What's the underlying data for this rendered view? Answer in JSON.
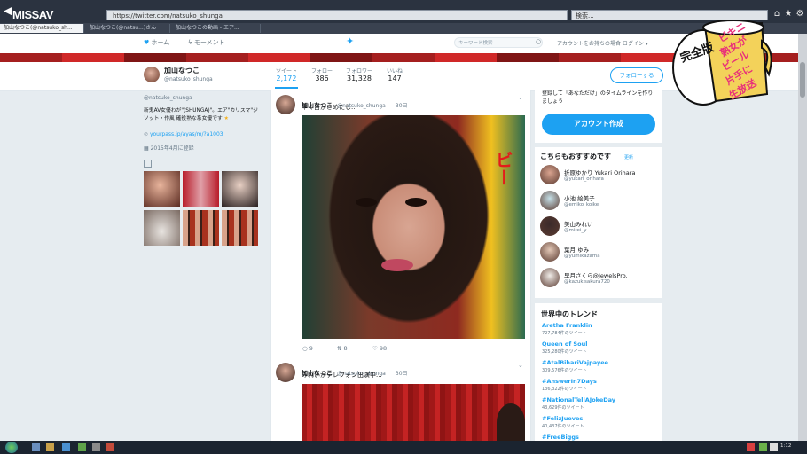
{
  "watermark": "MISSAV",
  "browser": {
    "url": "https://twitter.com/natsuko_shunga",
    "search_placeholder": "検索...",
    "tabs": [
      "加山なつこ(@natsuko_sh...",
      "加山なつこ(@natsu...)さん",
      "加山なつこの動画 - エア..."
    ]
  },
  "nav": {
    "home": "ホーム",
    "moments": "モーメント",
    "search_placeholder": "キーワード検索",
    "login_prompt": "アカウントをお持ちの場合 ログイン ▾"
  },
  "profile": {
    "name": "加山なつこ",
    "handle": "@natsuko_shunga",
    "bio": "新鬼AV女優わが\"(SHUNGA)\"。エア\"カリスマ\"ジ ソット・作風 確役熟な系女優です",
    "link": "yourpass.jp/ayas/m/?a1003",
    "joined": "2015年4月に登録",
    "follow_button": "フォローする"
  },
  "stats": [
    {
      "label": "ツイート",
      "value": "2,172"
    },
    {
      "label": "フォロー",
      "value": "386"
    },
    {
      "label": "フォロワー",
      "value": "31,328"
    },
    {
      "label": "いいね",
      "value": "147"
    }
  ],
  "tweets": [
    {
      "name": "加山なつこ",
      "handle": "@natsuko_shunga",
      "time": "30日",
      "text": "早く目がさめたし...",
      "image_sign": "ビー",
      "replies": "9",
      "retweets": "8",
      "likes": "98"
    },
    {
      "name": "加山なつこ",
      "handle": "@natsuko_shunga",
      "time": "30日",
      "text": "みれいがテレフォン出演中..."
    }
  ],
  "signup": {
    "text": "登録して「あなただけ」のタイムラインを作りましょう",
    "button": "アカウント作成"
  },
  "recommend": {
    "title": "こちらもおすすめです",
    "refresh": "更新",
    "users": [
      {
        "name": "折原ゆかり Yukari Orihara",
        "handle": "@yukari_orihara",
        "color": "#d9a38f"
      },
      {
        "name": "小池 絵美子",
        "handle": "@emiko_koike",
        "color": "#c5e0e8"
      },
      {
        "name": "美山みれい",
        "handle": "@mirei_y",
        "color": "#3b2a2a"
      },
      {
        "name": "葉月 ゆみ",
        "handle": "@yumikazama",
        "color": "#e2c7b6"
      },
      {
        "name": "早月さくら@JewelsPro.",
        "handle": "@kazukisakura720",
        "color": "#f0ece8"
      }
    ]
  },
  "trends": {
    "title": "世界中のトレンド",
    "items": [
      {
        "name": "Aretha Franklin",
        "count": "727,784件のツイート"
      },
      {
        "name": "Queen of Soul",
        "count": "325,280件のツイート"
      },
      {
        "name": "#AtalBihariVajpayee",
        "count": "309,576件のツイート"
      },
      {
        "name": "#AnswerIn7Days",
        "count": "136,322件のツイート"
      },
      {
        "name": "#NationalTellAJokeDay",
        "count": "43,629件のツイート"
      },
      {
        "name": "#FelizJueves",
        "count": "40,437件のツイート"
      },
      {
        "name": "#FreeBiggs",
        "count": ""
      }
    ]
  },
  "overlay_badge": {
    "lines": [
      "ビキニ",
      "熟女が",
      "ビール",
      "片手に",
      "生放送",
      "完全版"
    ]
  },
  "taskbar": {
    "clock": "1:12"
  }
}
